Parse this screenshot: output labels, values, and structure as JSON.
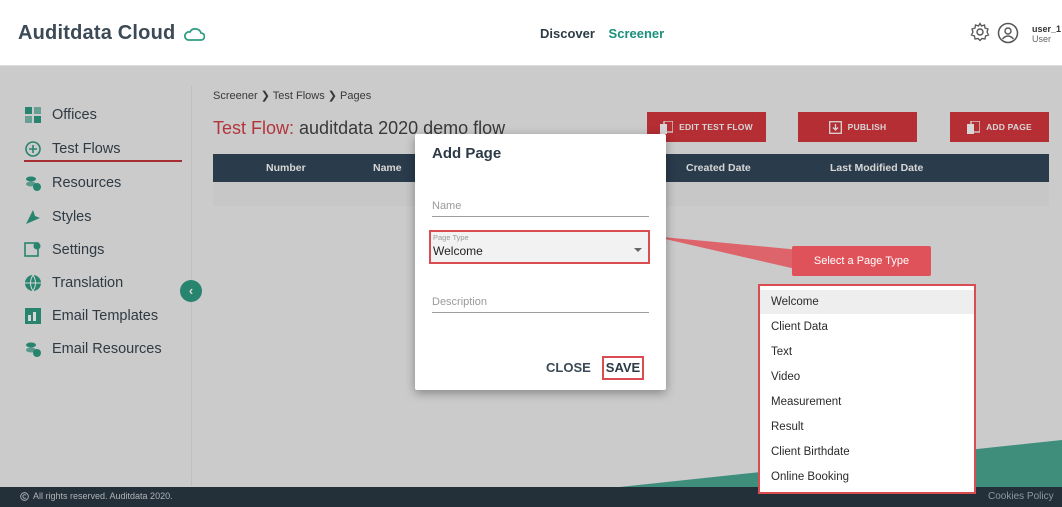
{
  "header": {
    "logo": "Auditdata Cloud",
    "nav": {
      "discover": "Discover",
      "screener": "Screener"
    },
    "user": {
      "name": "user_1",
      "role": "User"
    }
  },
  "sidebar": {
    "items": [
      {
        "label": "Offices",
        "icon": "offices-icon"
      },
      {
        "label": "Test Flows",
        "icon": "test-flows-icon",
        "active": true
      },
      {
        "label": "Resources",
        "icon": "resources-icon"
      },
      {
        "label": "Styles",
        "icon": "styles-icon"
      },
      {
        "label": "Settings",
        "icon": "settings-icon"
      },
      {
        "label": "Translation",
        "icon": "translation-icon"
      },
      {
        "label": "Email Templates",
        "icon": "email-templates-icon"
      },
      {
        "label": "Email Resources",
        "icon": "email-resources-icon"
      }
    ],
    "collapse_glyph": "‹"
  },
  "main": {
    "breadcrumb": "Screener ❯ Test Flows ❯ Pages",
    "title_prefix": "Test Flow:",
    "title_name": " auditdata 2020 demo flow",
    "buttons": {
      "edit": "EDIT TEST FLOW",
      "publish": "PUBLISH",
      "add": "ADD PAGE"
    },
    "table_headers": [
      "Number",
      "Name",
      "Created Date",
      "Last Modified Date"
    ]
  },
  "modal": {
    "title": "Add Page",
    "name_placeholder": "Name",
    "page_type_label": "Page Type",
    "page_type_value": "Welcome",
    "description_placeholder": "Description",
    "close_label": "CLOSE",
    "save_label": "SAVE"
  },
  "callout": "Select a Page Type",
  "dropdown_options": [
    "Welcome",
    "Client Data",
    "Text",
    "Video",
    "Measurement",
    "Result",
    "Client Birthdate",
    "Online Booking"
  ],
  "footer": {
    "copyright": "All rights reserved. Auditdata 2020.",
    "cookies": "Cookies Policy"
  },
  "colors": {
    "accent_red": "#d7373e",
    "teal": "#1a8f7a",
    "table_head": "#33475b",
    "footer": "#2a3845"
  }
}
